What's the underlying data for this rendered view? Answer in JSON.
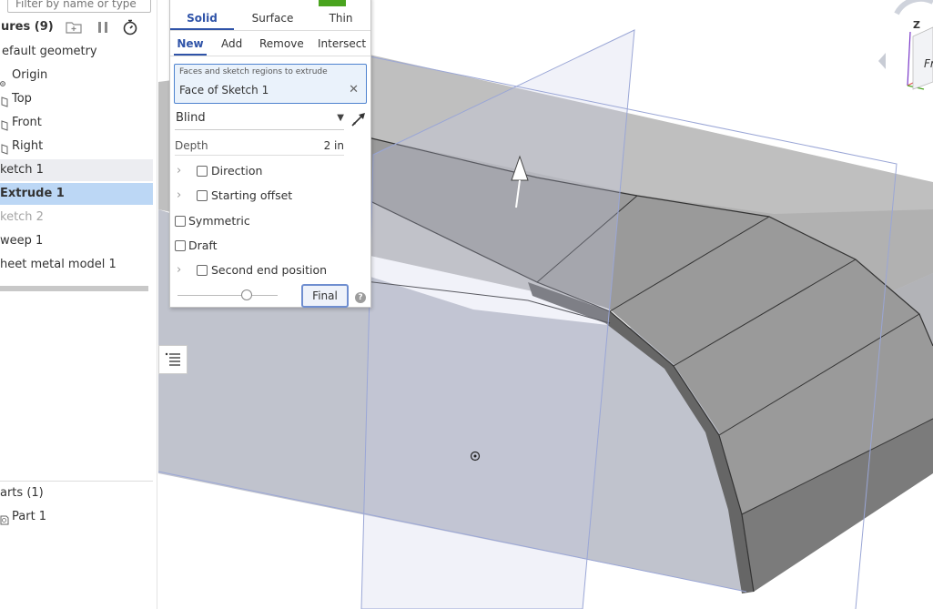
{
  "feature_tree": {
    "filter_placeholder": "Filter by name or type",
    "header_title": "ures (9)",
    "items": [
      {
        "label": "efault geometry"
      },
      {
        "label": "Origin"
      },
      {
        "label": "Top"
      },
      {
        "label": "Front"
      },
      {
        "label": "Right"
      },
      {
        "label": "ketch 1"
      },
      {
        "label": "Extrude 1"
      },
      {
        "label": "ketch 2"
      },
      {
        "label": "weep 1"
      },
      {
        "label": "heet metal model 1"
      }
    ],
    "parts_header": "arts (1)",
    "parts": [
      {
        "label": "Part 1"
      }
    ]
  },
  "extrude_dialog": {
    "body_types": [
      "Solid",
      "Surface",
      "Thin"
    ],
    "active_body_type": "Solid",
    "operations": [
      "New",
      "Add",
      "Remove",
      "Intersect"
    ],
    "active_operation": "New",
    "faces_label": "Faces and sketch regions to extrude",
    "faces_value": "Face of Sketch 1",
    "end_type": "Blind",
    "depth_label": "Depth",
    "depth_value": "2 in",
    "options": {
      "direction": "Direction",
      "starting_offset": "Starting offset",
      "symmetric": "Symmetric",
      "draft": "Draft",
      "second_end": "Second end position"
    },
    "final_button": "Final",
    "help": "?"
  },
  "view_cube": {
    "z_label": "Z",
    "face_label": "Fr"
  },
  "colors": {
    "accent": "#2f53a8",
    "selection": "#bcd7f5",
    "confirm_green": "#4aa41f",
    "plane": "#7f8fd0"
  }
}
